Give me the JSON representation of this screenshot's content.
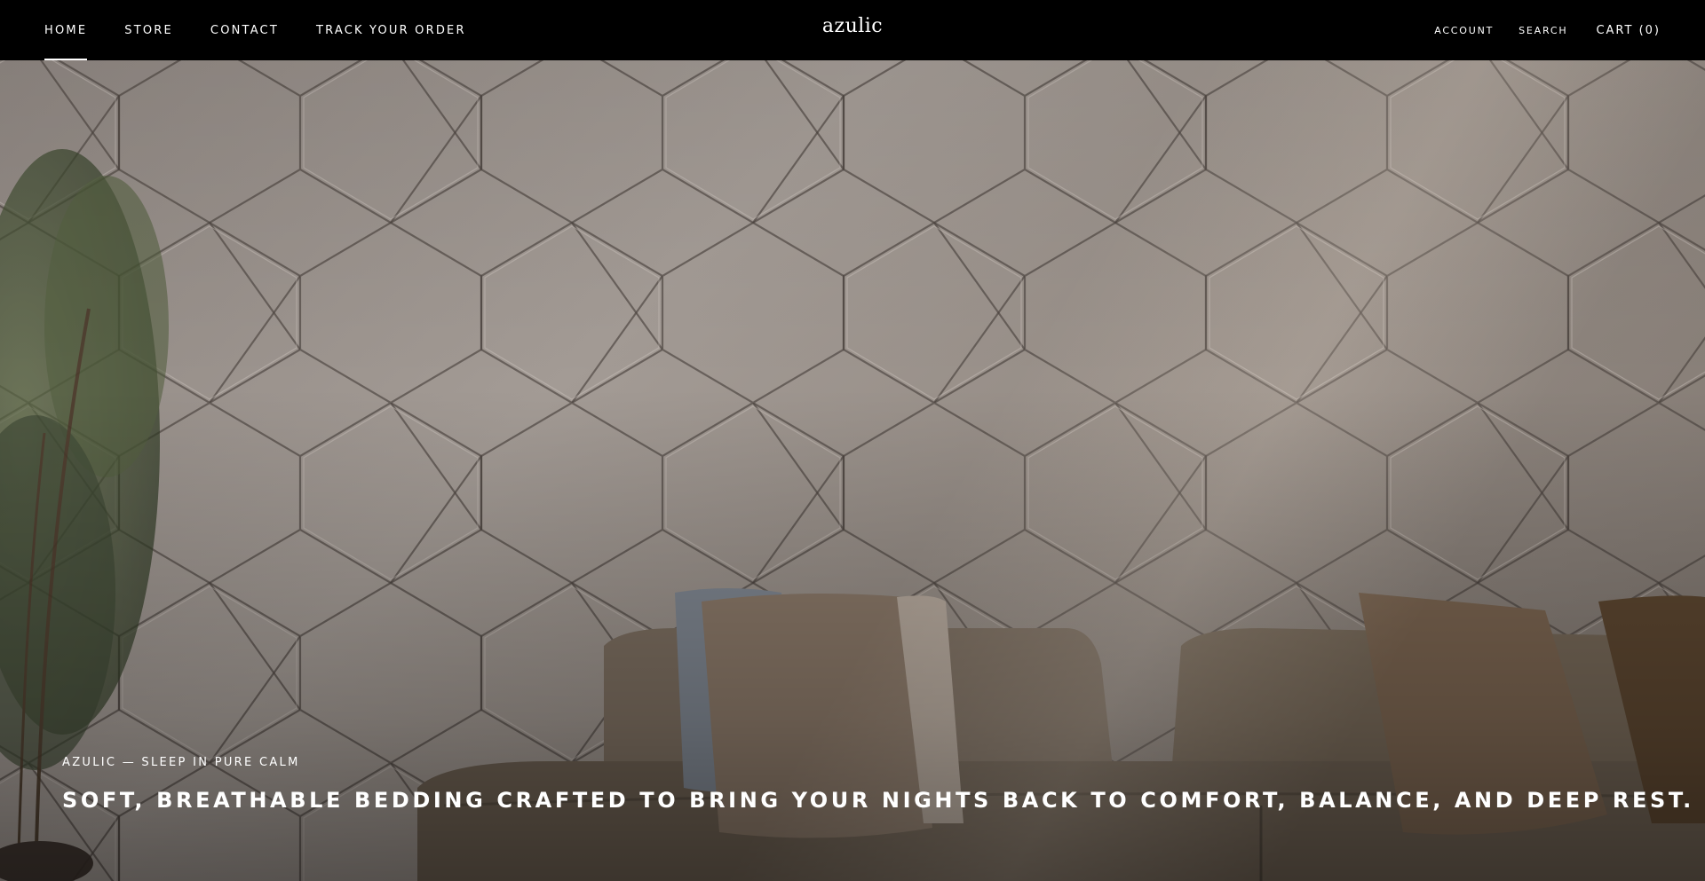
{
  "header": {
    "nav_left": [
      {
        "label": "HOME",
        "active": true
      },
      {
        "label": "STORE",
        "active": false
      },
      {
        "label": "CONTACT",
        "active": false
      },
      {
        "label": "TRACK YOUR ORDER",
        "active": false
      }
    ],
    "logo": "azulic",
    "account_label": "ACCOUNT",
    "search_label": "SEARCH",
    "cart_label": "CART (0)"
  },
  "hero": {
    "caption": "AZULIC — SLEEP IN PURE CALM",
    "title": "SOFT, BREATHABLE BEDDING CRAFTED TO BRING YOUR NIGHTS BACK TO COMFORT, BALANCE, AND DEEP REST."
  },
  "colors": {
    "header_bg": "#000000",
    "text": "#ffffff",
    "wall": "#a39b95",
    "sofa": "#7a6a58"
  }
}
